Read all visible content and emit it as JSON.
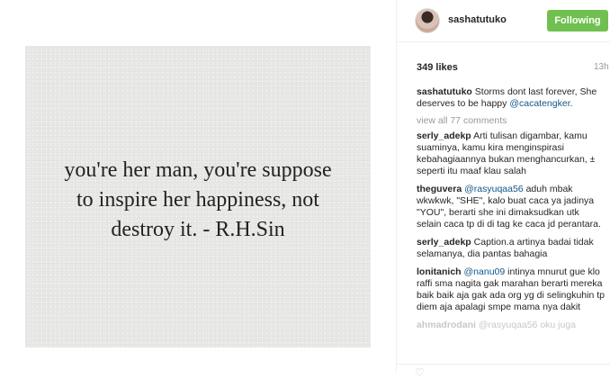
{
  "post": {
    "username": "sashatutuko",
    "follow_label": "Following",
    "likes": "349 likes",
    "time_ago": "13h",
    "photo_quote": [
      "you're her man, you're suppose",
      "to inspire her happiness, not",
      "destroy it. - R.H.Sin"
    ]
  },
  "caption": {
    "user": "sashatutuko",
    "text": "Storms dont last forever, She deserves to be happy",
    "mention": "@cacatengker",
    "end": "."
  },
  "view_all": "view all 77 comments",
  "comments": [
    {
      "user": "serly_adekp",
      "mention": "",
      "text": "Arti tulisan digambar, kamu suaminya, kamu kira menginspirasi kebahagiaannya bukan menghancurkan, ± seperti itu maaf klau salah"
    },
    {
      "user": "theguvera",
      "mention": "@rasyuqaa56",
      "text": "aduh mbak wkwkwk, \"SHE\", kalo buat caca ya jadinya \"YOU\", berarti she ini dimaksudkan utk selain caca tp di di tag ke caca jd perantara."
    },
    {
      "user": "serly_adekp",
      "mention": "",
      "text": "Caption.a artinya badai tidak selamanya, dia pantas bahagia"
    },
    {
      "user": "lonitanich",
      "mention": "@nanu09",
      "text": "intinya mnurut gue klo raffi sma nagita gak marahan berarti mereka baik baik aja gak ada org yg di selingkuhin tp diem aja apalagi smpe mama nya dakit"
    },
    {
      "user": "ahmadrodani",
      "mention": "@rasyuqaa56",
      "text": "oku juga"
    }
  ]
}
